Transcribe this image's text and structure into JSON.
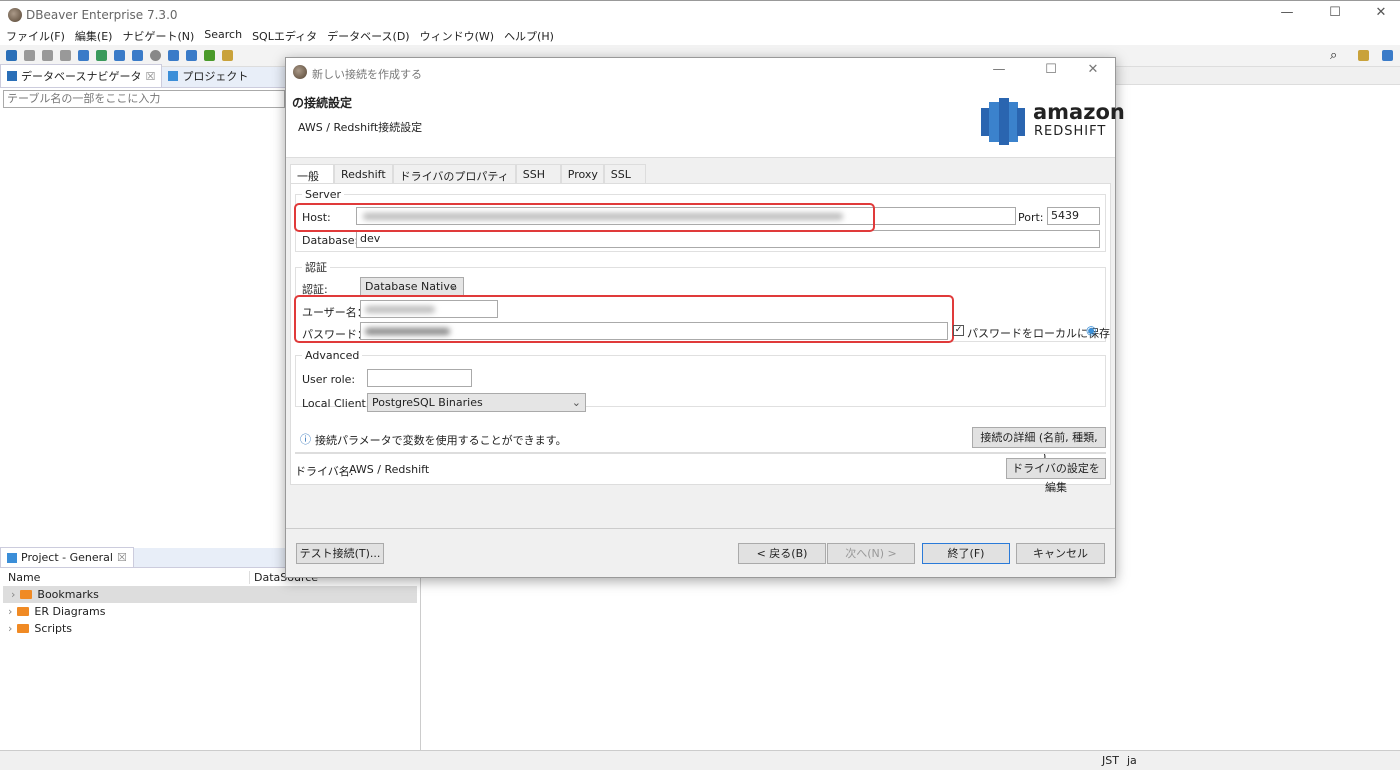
{
  "app": {
    "title": "DBeaver Enterprise 7.3.0",
    "window_controls": [
      "—",
      "☐",
      "✕"
    ]
  },
  "menu": [
    "ファイル(F)",
    "編集(E)",
    "ナビゲート(N)",
    "Search",
    "SQLエディタ",
    "データベース(D)",
    "ウィンドウ(W)",
    "ヘルプ(H)"
  ],
  "navigator": {
    "tabs": [
      "データベースナビゲータ",
      "プロジェクト"
    ],
    "filter_placeholder": "テーブル名の一部をここに入力"
  },
  "project": {
    "tab": "Project - General",
    "columns": [
      "Name",
      "DataSource"
    ],
    "items": [
      "Bookmarks",
      "ER Diagrams",
      "Scripts"
    ]
  },
  "status": {
    "timezone": "JST",
    "locale": "ja"
  },
  "dialog": {
    "title": "新しい接続を作成する",
    "heading": "の接続設定",
    "subheading": "AWS / Redshift接続設定",
    "logo": {
      "line1": "amazon",
      "line2": "REDSHIFT"
    },
    "tabs": [
      "一般",
      "Redshift",
      "ドライバのプロパティ",
      "SSH",
      "Proxy",
      "SSL"
    ],
    "server": {
      "legend": "Server",
      "host_label": "Host:",
      "port_label": "Port:",
      "port": "5439",
      "database_label": "Database:",
      "database": "dev"
    },
    "auth": {
      "legend": "認証",
      "auth_label": "認証:",
      "auth_value": "Database Native",
      "user_label": "ユーザー名：",
      "password_label": "パスワード：",
      "save_password": "パスワードをローカルに保存",
      "save_password_checked": true
    },
    "advanced": {
      "legend": "Advanced",
      "role_label": "User role:",
      "role": "",
      "client_label": "Local Client:",
      "client": "PostgreSQL Binaries"
    },
    "info": "接続パラメータで変数を使用することができます。",
    "details_button": "接続の詳細 (名前, 種類, ...)",
    "driver_label": "ドライバ名:",
    "driver": "AWS / Redshift",
    "driver_button": "ドライバの設定を編集",
    "buttons": {
      "test": "テスト接続(T)...",
      "back": "< 戻る(B)",
      "next": "次へ(N) >",
      "finish": "終了(F)",
      "cancel": "キャンセル"
    }
  }
}
